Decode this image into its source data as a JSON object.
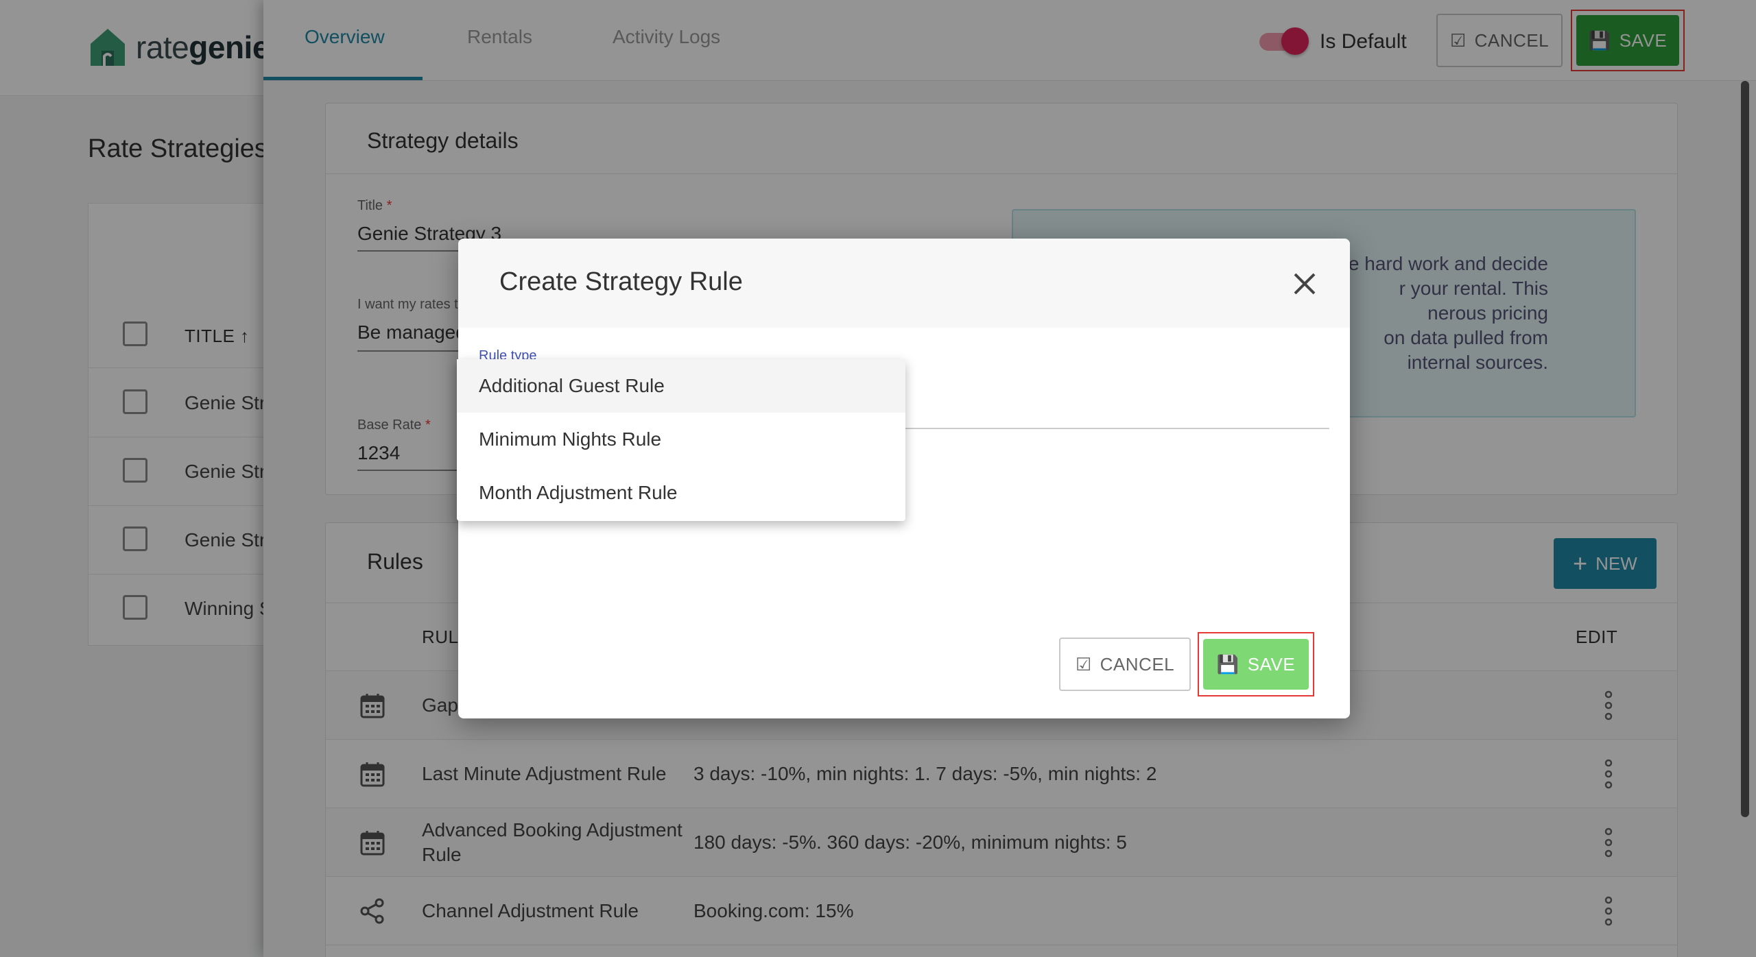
{
  "brand": {
    "name_light": "rate",
    "name_bold": "genie"
  },
  "page": {
    "heading": "Rate Strategies",
    "list": {
      "column_title": "TITLE",
      "rows": [
        "Genie Stra",
        "Genie Stra",
        "Genie Stra",
        "Winning S"
      ]
    }
  },
  "panel": {
    "tabs": [
      "Overview",
      "Rentals",
      "Activity Logs"
    ],
    "active_tab": "Overview",
    "is_default_label": "Is Default",
    "is_default_on": true,
    "cancel_label": "CANCEL",
    "save_label": "SAVE",
    "strategy_details": {
      "title": "Strategy details",
      "title_field": {
        "label": "Title",
        "value": "Genie Strategy 3"
      },
      "rates_field": {
        "label": "I want my rates to",
        "value": "Be managed"
      },
      "base_rate_field": {
        "label": "Base Rate",
        "value": "1234"
      },
      "info_lines": [
        "e hard work and decide",
        "r your rental. This",
        "nerous pricing",
        "on data pulled from",
        "internal sources."
      ]
    },
    "rules": {
      "title": "Rules",
      "new_label": "NEW",
      "col_rule": "RULE",
      "col_edit": "EDIT",
      "rows": [
        {
          "icon": "calendar-icon",
          "name": "Gap",
          "desc": ""
        },
        {
          "icon": "calendar-icon",
          "name": "Last Minute Adjustment Rule",
          "desc": "3 days: -10%, min nights: 1. 7 days: -5%, min nights: 2"
        },
        {
          "icon": "calendar-icon",
          "name": "Advanced Booking Adjustment Rule",
          "desc": "180 days: -5%. 360 days: -20%, minimum nights: 5"
        },
        {
          "icon": "share-icon",
          "name": "Channel Adjustment Rule",
          "desc": "Booking.com: 15%"
        }
      ]
    }
  },
  "modal": {
    "title": "Create Strategy Rule",
    "rule_type_label": "Rule type",
    "options": [
      "Additional Guest Rule",
      "Minimum Nights Rule",
      "Month Adjustment Rule"
    ],
    "cancel_label": "CANCEL",
    "save_label": "SAVE"
  },
  "colors": {
    "accent": "#1f8aa8",
    "save_green": "#2e9e3a",
    "save_green_light": "#7ed873",
    "toggle": "#e0245e",
    "highlight": "#e53935"
  }
}
